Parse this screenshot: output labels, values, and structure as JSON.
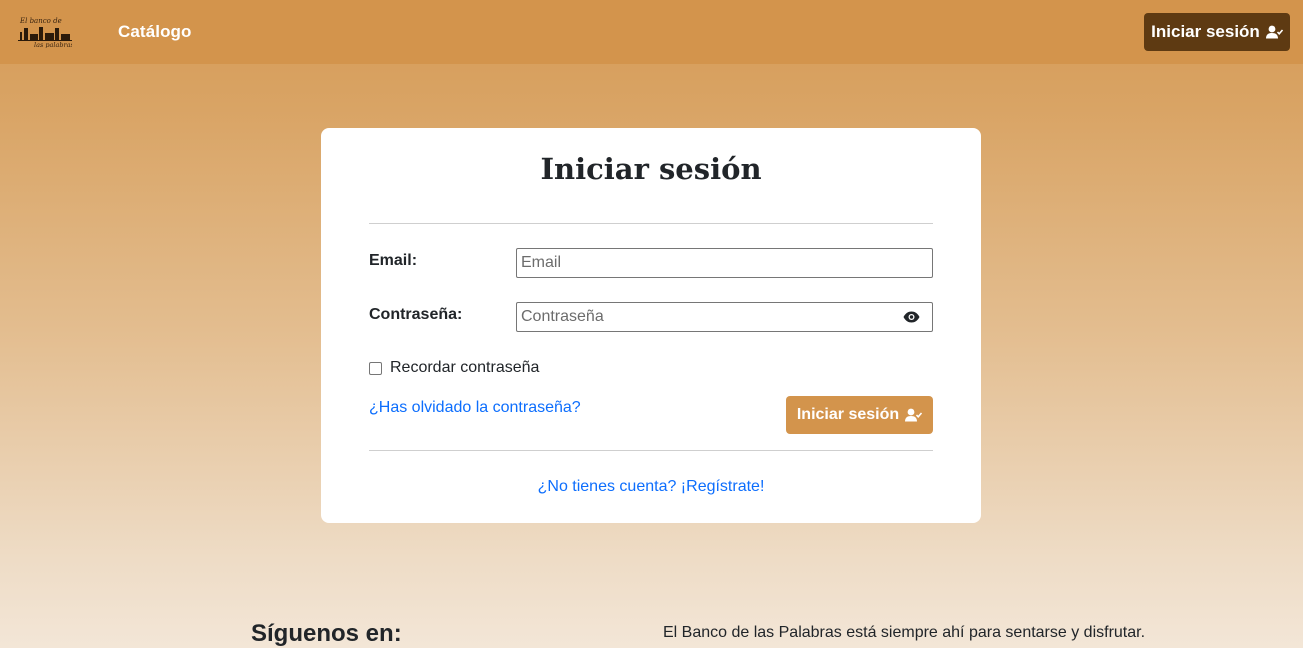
{
  "navbar": {
    "logo_text": "El banco de las palabras",
    "catalog_label": "Catálogo",
    "login_label": "Iniciar sesión"
  },
  "login_card": {
    "title": "Iniciar sesión",
    "email_label": "Email:",
    "email_placeholder": "Email",
    "email_value": "",
    "password_label": "Contraseña:",
    "password_placeholder": "Contraseña",
    "password_value": "",
    "remember_label": "Recordar contraseña",
    "remember_checked": false,
    "forgot_label": "¿Has olvidado la contraseña?",
    "submit_label": "Iniciar sesión",
    "register_label": "¿No tienes cuenta? ¡Regístrate!"
  },
  "footer": {
    "follow_title": "Síguenos en:",
    "tagline": "El Banco de las Palabras está siempre ahí para sentarse y disfrutar."
  },
  "colors": {
    "navbar": "#d3944c",
    "nav_button": "#5e3a12",
    "primary_button": "#d3944c",
    "link": "#0d6efd"
  },
  "icons": {
    "login": "user-check-icon",
    "password_toggle": "eye-icon"
  }
}
